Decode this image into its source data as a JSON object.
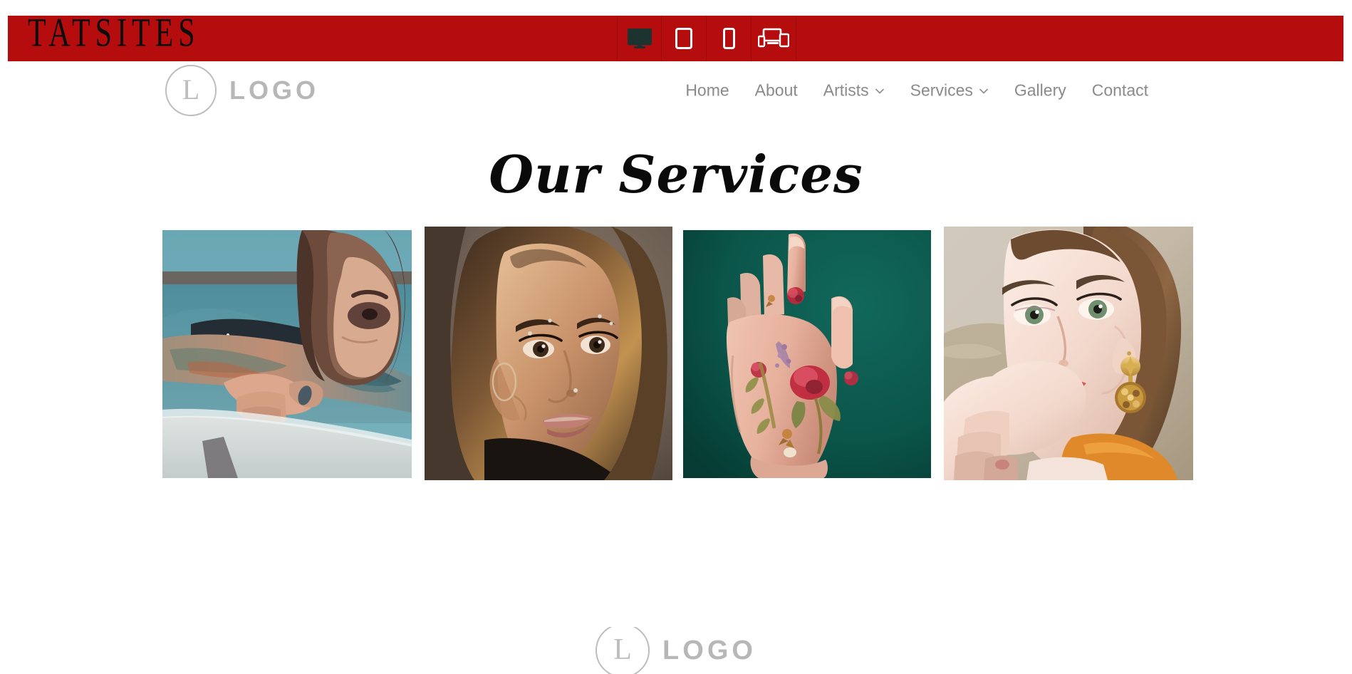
{
  "toolbar": {
    "brand": "TATSITES",
    "accent_color": "#b50d0d",
    "devices": [
      {
        "name": "desktop-preview",
        "label": "Desktop",
        "icon": "monitor-icon",
        "active": true
      },
      {
        "name": "tablet-preview",
        "label": "Tablet",
        "icon": "tablet-icon",
        "active": false
      },
      {
        "name": "mobile-preview",
        "label": "Mobile",
        "icon": "mobile-icon",
        "active": false
      },
      {
        "name": "responsive-preview",
        "label": "All Devices",
        "icon": "multi-device-icon",
        "active": false
      }
    ]
  },
  "header": {
    "logo": {
      "mark_letter": "L",
      "word": "LOGO",
      "color": "#bdbdbd"
    },
    "nav": [
      {
        "label": "Home",
        "has_dropdown": false
      },
      {
        "label": "About",
        "has_dropdown": false
      },
      {
        "label": "Artists",
        "has_dropdown": true
      },
      {
        "label": "Services",
        "has_dropdown": true
      },
      {
        "label": "Gallery",
        "has_dropdown": false
      },
      {
        "label": "Contact",
        "has_dropdown": false
      }
    ]
  },
  "main": {
    "title": "Our Services",
    "gallery": [
      {
        "name": "service-image-1",
        "alt": "Tattooed person resting on surfboard in teal water",
        "palette": {
          "bg": "#5b99a8",
          "skin": "#d8a288",
          "accent": "#2f4a52",
          "ink": "#3d6f7a"
        }
      },
      {
        "name": "service-image-2",
        "alt": "Portrait of woman with eyebrow and nose piercings",
        "palette": {
          "bg": "#6d6056",
          "skin": "#c49a76",
          "accent": "#2a2119",
          "ink": "#8a6a4a"
        }
      },
      {
        "name": "service-image-3",
        "alt": "Hand with floral rose tattoos on teal green background",
        "palette": {
          "bg": "#0c5b50",
          "skin": "#e8b8a6",
          "accent": "#c0304a",
          "ink": "#8a7a4a"
        }
      },
      {
        "name": "service-image-4",
        "alt": "Portrait of woman with gold earring and orange top",
        "palette": {
          "bg": "#cdbfae",
          "skin": "#f0d9cc",
          "accent": "#d4882a",
          "ink": "#6b4a38"
        }
      }
    ]
  },
  "footer": {
    "logo": {
      "mark_letter": "L",
      "word": "LOGO",
      "color": "#bdbdbd"
    }
  }
}
